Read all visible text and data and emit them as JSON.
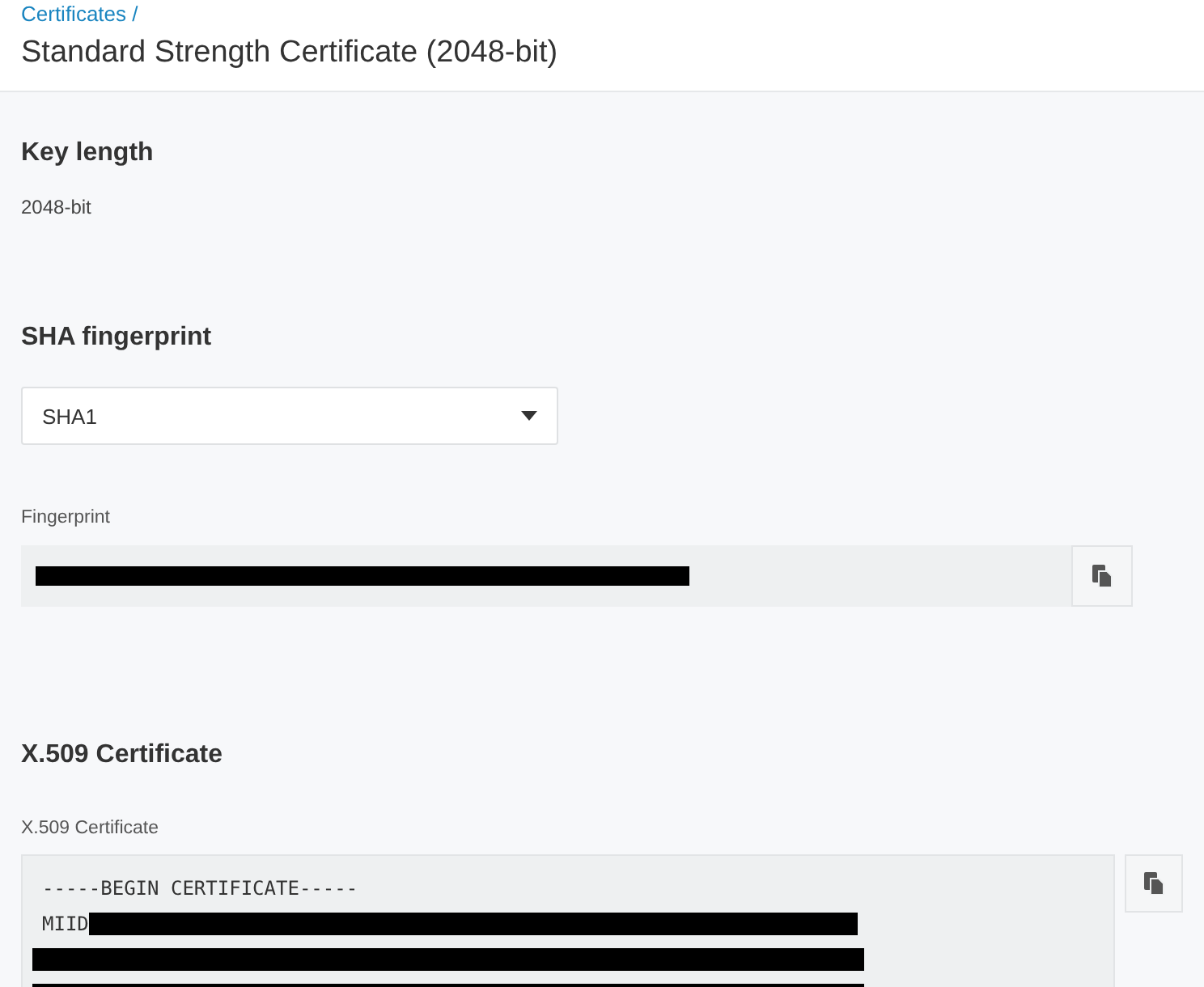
{
  "header": {
    "breadcrumb": "Certificates /",
    "title": "Standard Strength Certificate (2048-bit)"
  },
  "key_length": {
    "heading": "Key length",
    "value": "2048-bit"
  },
  "sha_fingerprint": {
    "heading": "SHA fingerprint",
    "select": {
      "value": "SHA1"
    },
    "field_label": "Fingerprint",
    "fingerprint": {
      "redacted": true
    }
  },
  "x509": {
    "heading": "X.509 Certificate",
    "field_label": "X.509 Certificate",
    "lines": [
      {
        "text": "-----BEGIN CERTIFICATE-----",
        "redacted": false
      },
      {
        "text": "MIID",
        "redacted": true
      },
      {
        "redacted": true
      },
      {
        "redacted": true
      }
    ]
  }
}
